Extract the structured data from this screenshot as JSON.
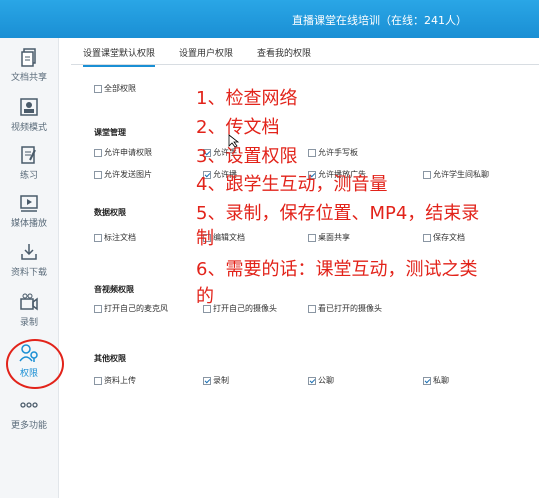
{
  "header": {
    "title": "直播课堂在线培训（在线：241人）"
  },
  "sidebar": {
    "items": [
      {
        "label": "文档共享",
        "icon": "document-share-icon"
      },
      {
        "label": "视频模式",
        "icon": "video-mode-icon"
      },
      {
        "label": "练习",
        "icon": "exercise-icon"
      },
      {
        "label": "媒体播放",
        "icon": "media-play-icon"
      },
      {
        "label": "资料下载",
        "icon": "download-icon"
      },
      {
        "label": "录制",
        "icon": "record-icon"
      },
      {
        "label": "权限",
        "icon": "permission-icon"
      },
      {
        "label": "更多功能",
        "icon": "more-icon"
      }
    ]
  },
  "tabs": [
    "设置课堂默认权限",
    "设置用户权限",
    "查看我的权限"
  ],
  "permissions": {
    "all": "全部权限",
    "classroom": {
      "title": "课堂管理",
      "items": [
        "允许申请权限",
        "允许手",
        "允许手写板",
        "允许发送图片",
        "允许播",
        "允许播放广告",
        "允许学生间私聊"
      ]
    },
    "data": {
      "title": "数据权限",
      "items": [
        "标注文档",
        "编辑文档",
        "桌面共享",
        "保存文档"
      ]
    },
    "av": {
      "title": "音视频权限",
      "items": [
        "打开自己的麦克风",
        "打开自己的摄像头",
        "看已打开的摄像头"
      ]
    },
    "other": {
      "title": "其他权限",
      "items": [
        "资料上传",
        "录制",
        "公聊",
        "私聊"
      ]
    }
  },
  "annotations": [
    "1、检查网络",
    "2、传文档",
    "3、设置权限",
    "4、跟学生互动，测音量",
    "5、录制，保存位置、MP4，结束录",
    "制",
    "6、需要的话：课堂互动，测试之类",
    "的"
  ],
  "colors": {
    "accent": "#1a8fd4",
    "annotation": "#e2231a"
  }
}
